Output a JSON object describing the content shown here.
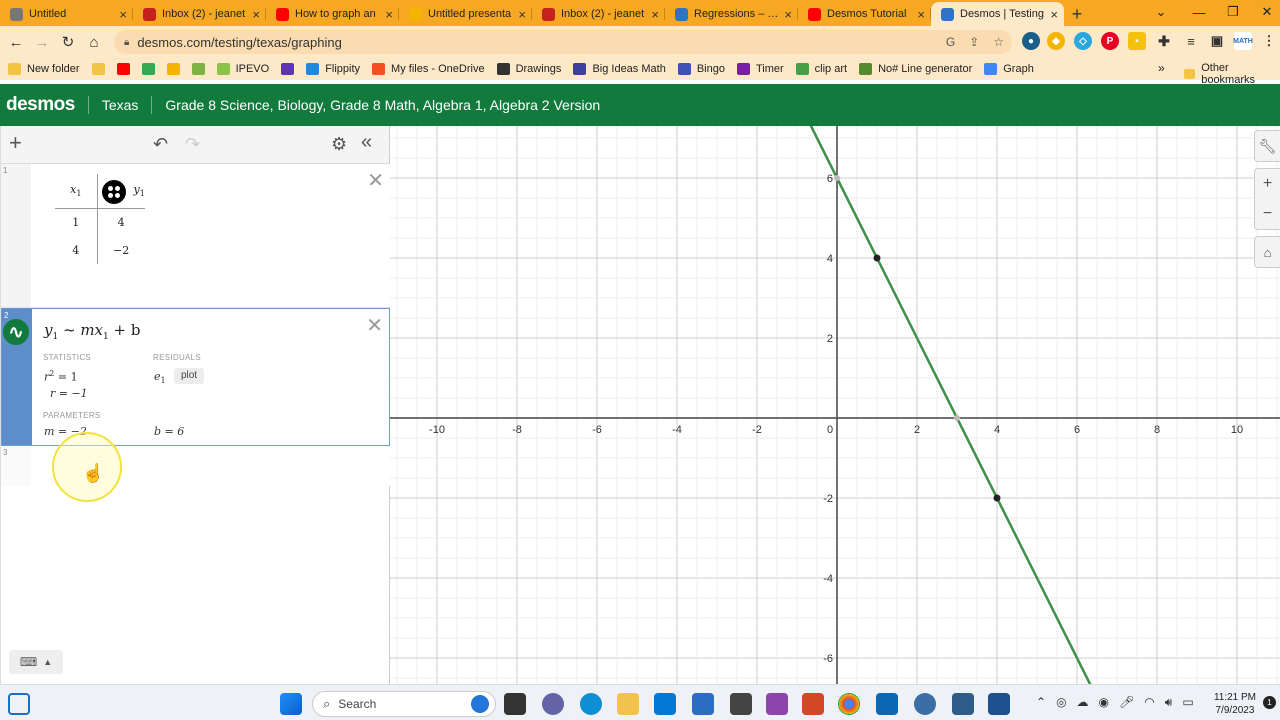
{
  "browser": {
    "tabs": [
      {
        "label": "Untitled",
        "icon": "globe-icon",
        "color": "#777777"
      },
      {
        "label": "Inbox (2) - jeanet",
        "icon": "gmail-icon",
        "color": "#c5221f"
      },
      {
        "label": "How to graph an",
        "icon": "youtube-icon",
        "color": "#ff0000"
      },
      {
        "label": "Untitled presenta",
        "icon": "slides-icon",
        "color": "#f4b400"
      },
      {
        "label": "Inbox (2) - jeanet",
        "icon": "gmail-icon",
        "color": "#c5221f"
      },
      {
        "label": "Regressions – De",
        "icon": "desmos-icon",
        "color": "#2f74c0"
      },
      {
        "label": "Desmos Tutorial",
        "icon": "youtube-icon",
        "color": "#ff0000"
      },
      {
        "label": "Desmos | Testing",
        "icon": "desmos-d-icon",
        "color": "#2f74c0",
        "active": true
      }
    ],
    "url": "desmos.com/testing/texas/graphing",
    "bookmarks": [
      {
        "label": "New folder",
        "color": "#f3c443"
      },
      {
        "label": "",
        "color": "#f3c443"
      },
      {
        "label": "",
        "color": "#ff0000"
      },
      {
        "label": "",
        "color": "#34a853"
      },
      {
        "label": "",
        "color": "#f4b400"
      },
      {
        "label": "",
        "color": "#7cb342"
      },
      {
        "label": "IPEVO",
        "color": "#8bc34a"
      },
      {
        "label": "",
        "color": "#5e35b1"
      },
      {
        "label": "Flippity",
        "color": "#1e88e5"
      },
      {
        "label": "My files - OneDrive",
        "color": "#f25022"
      },
      {
        "label": "Drawings",
        "color": "#333333"
      },
      {
        "label": "Big Ideas Math",
        "color": "#3f3f9f"
      },
      {
        "label": "Bingo",
        "color": "#3f51b5"
      },
      {
        "label": "Timer",
        "color": "#7b1fa2"
      },
      {
        "label": "clip art",
        "color": "#43a047"
      },
      {
        "label": "No# Line generator",
        "color": "#558b2f"
      },
      {
        "label": "Graph",
        "color": "#4285f4"
      }
    ],
    "more_bookmarks": "»",
    "other_bookmarks": "Other bookmarks"
  },
  "desmos": {
    "logo": "desmos",
    "region": "Texas",
    "version": "Grade 8 Science, Biology, Grade 8 Math, Algebra 1, Algebra 2 Version",
    "header_color": "#127a3d"
  },
  "expressions": {
    "table": {
      "index": "1",
      "col1_header": "x",
      "col1_sub": "1",
      "col2_header": "y",
      "col2_sub": "1",
      "rows": [
        [
          "1",
          "4"
        ],
        [
          "4",
          "−2"
        ]
      ]
    },
    "regression": {
      "index": "2",
      "formula": {
        "y": "y",
        "sub1": "1",
        "mid": " ~ mx",
        "sub2": "1",
        "end": " + b"
      },
      "statistics_label": "STATISTICS",
      "r2": {
        "base": "r",
        "sup": "2",
        "rest": " = 1"
      },
      "r": "r = −1",
      "residuals_label": "RESIDUALS",
      "residual_var": "e",
      "residual_sub": "1",
      "plot_label": "plot",
      "parameters_label": "PARAMETERS",
      "m": "m = −2",
      "b": "b = 6"
    },
    "empty_index": "3"
  },
  "graph": {
    "x_ticks": [
      "-10",
      "-8",
      "-6",
      "-4",
      "-2",
      "0",
      "2",
      "4",
      "6",
      "8",
      "10"
    ],
    "y_ticks": [
      "6",
      "4",
      "2",
      "-2",
      "-4",
      "-6"
    ],
    "line_color": "#3f8f47",
    "point_color": "#222222",
    "points": [
      [
        1,
        4
      ],
      [
        4,
        -2
      ]
    ],
    "line": {
      "slope": -2,
      "intercept": 6
    }
  },
  "taskbar": {
    "search_label": "Search",
    "time": "11:21 PM",
    "date": "7/9/2023"
  }
}
